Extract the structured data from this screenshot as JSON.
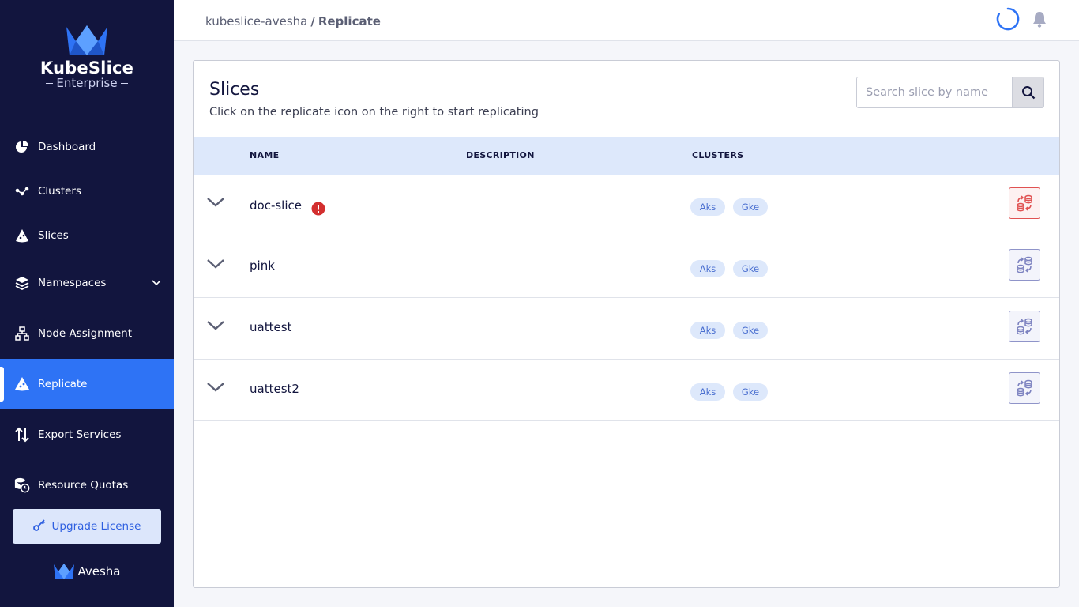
{
  "brand": {
    "title": "KubeSlice",
    "subtitle": "Enterprise",
    "footer": "Avesha"
  },
  "nav": [
    {
      "label": "Dashboard",
      "icon": "pie-chart-icon"
    },
    {
      "label": "Clusters",
      "icon": "nodes-icon"
    },
    {
      "label": "Slices",
      "icon": "slice-icon"
    },
    {
      "label": "Namespaces",
      "icon": "layers-icon"
    },
    {
      "label": "Node Assignment",
      "icon": "hierarchy-icon"
    },
    {
      "label": "Replicate",
      "icon": "replicate-icon",
      "active": true
    },
    {
      "label": "Export Services",
      "icon": "arrows-updown-icon"
    },
    {
      "label": "Resource Quotas",
      "icon": "database-clock-icon"
    }
  ],
  "upgrade_label": "Upgrade License",
  "breadcrumb": {
    "parent": "kubeslice-avesha",
    "separator": "/",
    "current": "Replicate"
  },
  "page": {
    "title": "Slices",
    "subtitle": "Click on the replicate icon on the right to start replicating",
    "search_placeholder": "Search slice by name"
  },
  "table": {
    "columns": [
      "NAME",
      "DESCRIPTION",
      "CLUSTERS"
    ],
    "rows": [
      {
        "name": "doc-slice",
        "description": "",
        "clusters": [
          "Aks",
          "Gke"
        ],
        "warning": true
      },
      {
        "name": "pink",
        "description": "",
        "clusters": [
          "Aks",
          "Gke"
        ],
        "warning": false
      },
      {
        "name": "uattest",
        "description": "",
        "clusters": [
          "Aks",
          "Gke"
        ],
        "warning": false
      },
      {
        "name": "uattest2",
        "description": "",
        "clusters": [
          "Aks",
          "Gke"
        ],
        "warning": false
      }
    ]
  },
  "colors": {
    "sidebar": "#12153e",
    "accent": "#2e73f5",
    "header_row": "#dde8fb",
    "warning": "#d32f2f"
  }
}
